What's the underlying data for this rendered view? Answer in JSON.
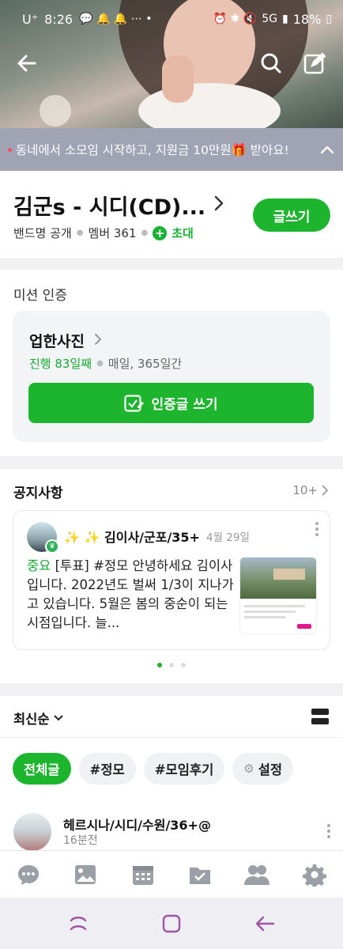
{
  "status_bar": {
    "carrier": "U⁺",
    "time": "8:26",
    "network": "5G",
    "battery": "18%"
  },
  "header": {
    "icons": [
      "back-arrow-icon",
      "search-icon",
      "compose-icon"
    ]
  },
  "promo_banner": {
    "text": "동네에서 소모임 시작하고, 지원금 10만원🎁 받아요!"
  },
  "band": {
    "title": "김군s - 시디(CD)...",
    "visibility": "밴드명 공개",
    "members": "멤버 361",
    "invite_label": "초대",
    "write_button": "글쓰기"
  },
  "mission": {
    "section_title": "미션 인증",
    "name": "업한사진",
    "progress": "진행 83일째",
    "period": "매일, 365일간",
    "button_label": "인증글 쓰기"
  },
  "notice": {
    "section_title": "공지사항",
    "count": "10+",
    "card": {
      "author_prefix": "✨ ✨",
      "author": "김이사/군포/35+",
      "date": "4월 29일",
      "tag": "중요",
      "body": "[투표] #정모 안녕하세요 김이사입니다. 2022년도 벌써 1/3이 지나가고 있습니다. 5월은 봄의 중순이 되는 시점입니다. 늘..."
    },
    "pager": {
      "count": 3,
      "active": 0
    }
  },
  "feed": {
    "sort_label": "최신순",
    "chips": [
      "전체글",
      "#정모",
      "#모임후기",
      "설정"
    ],
    "first_post": {
      "author": "헤르시나/시디/수원/36+@",
      "time": "16분전"
    }
  },
  "colors": {
    "accent": "#1db52d",
    "banner": "#9fa3b4"
  },
  "bottom_tabs": [
    "chat-icon",
    "photo-icon",
    "calendar-icon",
    "folder-icon",
    "members-icon",
    "settings-icon"
  ],
  "system_nav": [
    "recent-apps-icon",
    "home-icon",
    "back-icon"
  ]
}
